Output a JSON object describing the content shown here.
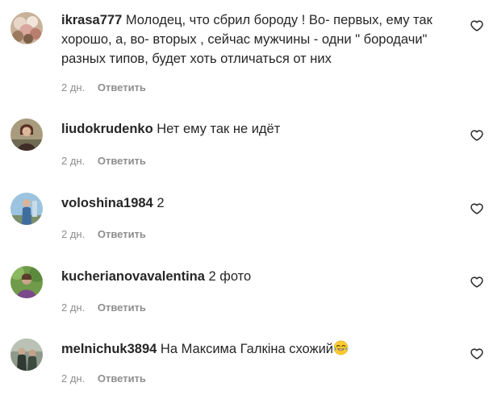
{
  "comments": [
    {
      "username": "ikrasa777",
      "text": "Молодец, что сбрил бороду ! Во- первых, ему так хорошо, а, во- вторых , сейчас мужчины - одни \" бородачи\" разных типов, будет хоть отличаться от них",
      "time": "2 дн.",
      "reply_label": "Ответить",
      "avatar_icon": "avatar-flowers"
    },
    {
      "username": "liudokrudenko",
      "text": "Нет ему так не идёт",
      "time": "2 дн.",
      "reply_label": "Ответить",
      "avatar_icon": "avatar-person"
    },
    {
      "username": "voloshina1984",
      "text": "2",
      "time": "2 дн.",
      "reply_label": "Ответить",
      "avatar_icon": "avatar-person-blue"
    },
    {
      "username": "kucherianovavalentina",
      "text": "2 фото",
      "time": "2 дн.",
      "reply_label": "Ответить",
      "avatar_icon": "avatar-person-green"
    },
    {
      "username": "melnichuk3894",
      "text": "На Максима Галкіна схожий",
      "emoji": "😂",
      "time": "2 дн.",
      "reply_label": "Ответить",
      "avatar_icon": "avatar-people"
    }
  ],
  "colors": {
    "text": "#262626",
    "secondary": "#8e8e8e",
    "background": "#ffffff"
  },
  "icons": {
    "like": "heart-outline-icon"
  }
}
